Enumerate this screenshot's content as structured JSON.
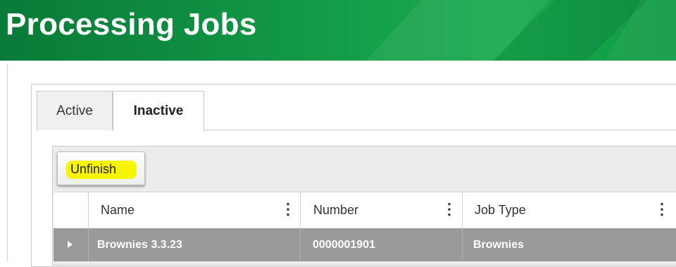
{
  "header": {
    "title": "Processing Jobs"
  },
  "tabs": [
    {
      "label": "Active",
      "selected": false
    },
    {
      "label": "Inactive",
      "selected": true
    }
  ],
  "toolbar": {
    "unfinish_label": "Unfinish",
    "highlight_color": "#f7f500"
  },
  "grid": {
    "columns": [
      {
        "label": "Name"
      },
      {
        "label": "Number"
      },
      {
        "label": "Job Type"
      }
    ],
    "rows": [
      {
        "name": "Brownies 3.3.23",
        "number": "0000001901",
        "job_type": "Brownies"
      }
    ]
  },
  "colors": {
    "brand_green": "#0f8f42",
    "selected_row": "#9a9a9a"
  }
}
